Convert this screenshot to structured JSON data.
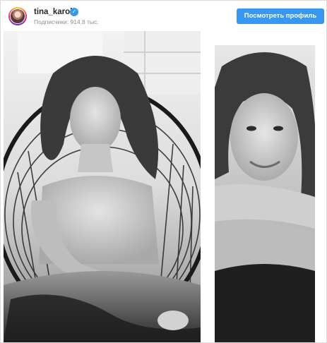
{
  "profile": {
    "username": "tina_karol",
    "verified_icon": "verified-check-icon",
    "followers_text": "Подписчики: 914.8 тыс.",
    "view_profile_label": "Посмотреть профиль"
  },
  "colors": {
    "button": "#3897f0",
    "username": "#262626",
    "secondary_text": "#8e8e8e"
  }
}
